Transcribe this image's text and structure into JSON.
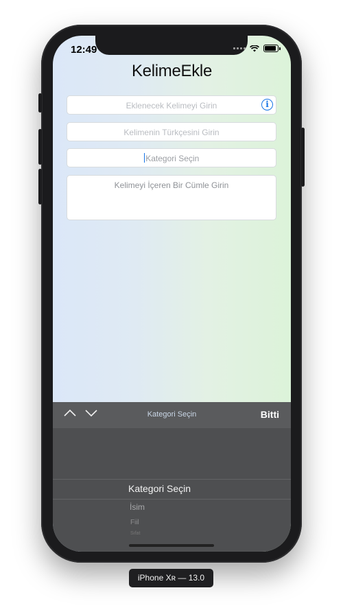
{
  "status_bar": {
    "time": "12:49"
  },
  "header": {
    "title": "KelimeEkle"
  },
  "form": {
    "word_placeholder": "Eklenecek Kelimeyi Girin",
    "turkish_placeholder": "Kelimenin Türkçesini Girin",
    "category_placeholder": "Kategori Seçin",
    "sentence_placeholder": "Kelimeyi İçeren Bir Cümle Girin"
  },
  "keyboard_toolbar": {
    "title": "Kategori Seçin",
    "done_label": "Bitti"
  },
  "picker": {
    "selected": "Kategori Seçin",
    "options": [
      "İsim",
      "Fiil",
      "Sıfat"
    ]
  },
  "device_label": "iPhone Xʀ — 13.0",
  "colors": {
    "accent": "#1473e6"
  },
  "icons": [
    "info-icon",
    "chevron-up-icon",
    "chevron-down-icon",
    "wifi-icon",
    "battery-icon",
    "signal-icon"
  ]
}
